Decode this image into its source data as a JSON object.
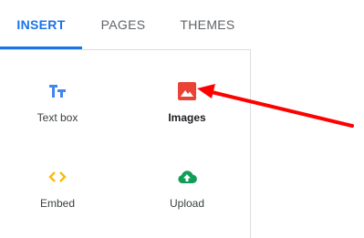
{
  "tabs": {
    "insert": "INSERT",
    "pages": "PAGES",
    "themes": "THEMES"
  },
  "insert_items": {
    "text_box": {
      "label": "Text box",
      "icon": "text-box-icon"
    },
    "images": {
      "label": "Images",
      "icon": "image-icon"
    },
    "embed": {
      "label": "Embed",
      "icon": "embed-icon"
    },
    "upload": {
      "label": "Upload",
      "icon": "upload-cloud-icon"
    }
  },
  "colors": {
    "active_tab": "#1a73e8",
    "text_box_icon": "#4285f4",
    "images_icon": "#ea4335",
    "embed_icon": "#fbbc04",
    "upload_icon": "#0f9d58",
    "annotation_arrow": "#ff0000"
  }
}
